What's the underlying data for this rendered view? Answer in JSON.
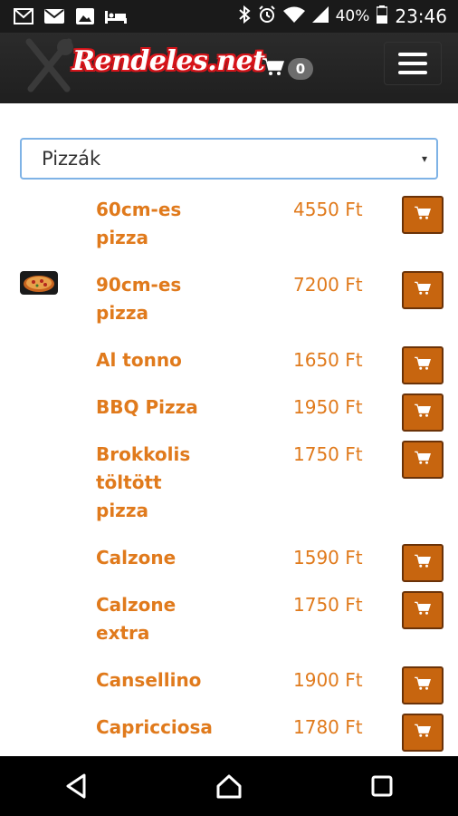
{
  "status_bar": {
    "battery": "40%",
    "time": "23:46",
    "icons": [
      "gmail-icon",
      "mail-icon",
      "image-icon",
      "bed-icon",
      "bluetooth-icon",
      "alarm-icon",
      "wifi-icon",
      "signal-icon",
      "battery-icon"
    ]
  },
  "header": {
    "logo_text": "Rendeles.net",
    "cart_count": "0",
    "cart_icon": "cart-icon",
    "menu_icon": "hamburger-icon"
  },
  "category_select": {
    "selected": "Pizzák",
    "caret": "▾"
  },
  "products": [
    {
      "name": "60cm-es pizza",
      "price": "4550 Ft",
      "lines": [
        "60cm-es",
        "pizza"
      ]
    },
    {
      "name": "90cm-es pizza",
      "price": "7200 Ft",
      "lines": [
        "90cm-es",
        "pizza"
      ],
      "has_thumbnail": true
    },
    {
      "name": "Al tonno",
      "price": "1650 Ft",
      "lines": [
        "Al tonno"
      ]
    },
    {
      "name": "BBQ Pizza",
      "price": "1950 Ft",
      "lines": [
        "BBQ Pizza"
      ]
    },
    {
      "name": "Brokkolis töltött pizza",
      "price": "1750 Ft",
      "lines": [
        "Brokkolis",
        "töltött",
        "pizza"
      ]
    },
    {
      "name": "Calzone",
      "price": "1590 Ft",
      "lines": [
        "Calzone"
      ]
    },
    {
      "name": "Calzone extra",
      "price": "1750 Ft",
      "lines": [
        "Calzone",
        "extra"
      ]
    },
    {
      "name": "Cansellino",
      "price": "1900 Ft",
      "lines": [
        "Cansellino"
      ]
    },
    {
      "name": "Capricciosa",
      "price": "1780 Ft",
      "lines": [
        "Capricciosa"
      ]
    }
  ],
  "colors": {
    "accent": "#e07a1c",
    "button": "#c7650f",
    "header_bg": "#252525",
    "logo_red": "#d7141a"
  },
  "nav_bar": {
    "icons": [
      "back-icon",
      "home-icon",
      "recents-icon"
    ]
  }
}
